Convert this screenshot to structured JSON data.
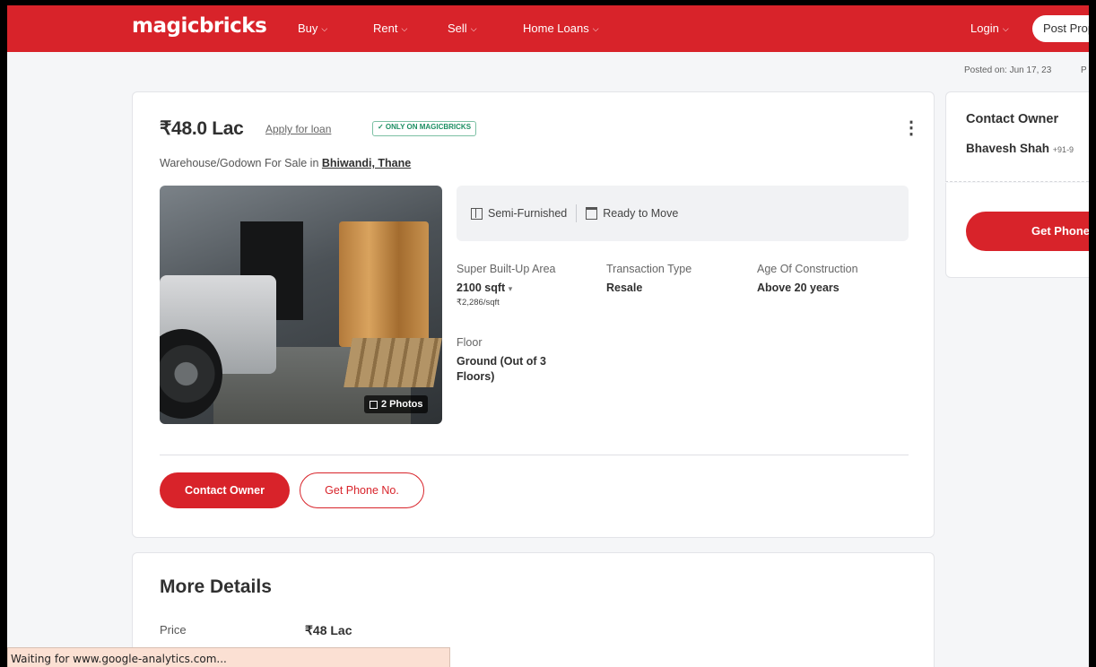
{
  "header": {
    "logo": "magicbricks",
    "nav": [
      {
        "label": "Buy"
      },
      {
        "label": "Rent"
      },
      {
        "label": "Sell"
      },
      {
        "label": "Home Loans"
      }
    ],
    "login_label": "Login",
    "post_property_label": "Post Prop",
    "brand_color": "#d8232a"
  },
  "posted_on": "Posted on: Jun 17, 23",
  "posted_on_trailing": "P",
  "listing": {
    "price": "₹48.0 Lac",
    "apply_loan": "Apply for loan",
    "badge": "✓ ONLY ON MAGICBRICKS",
    "more_icon": "⋮",
    "subtitle_prefix": "Warehouse/Godown For Sale in",
    "location": "Bhiwandi, Thane",
    "photos_badge": "2 Photos",
    "furnishing": "Semi-Furnished",
    "possession": "Ready to Move",
    "attributes": {
      "area_label": "Super Built-Up Area",
      "area_value": "2100 sqft",
      "area_rate": "₹2,286/sqft",
      "transaction_label": "Transaction Type",
      "transaction_value": "Resale",
      "age_label": "Age Of Construction",
      "age_value": "Above 20 years",
      "floor_label": "Floor",
      "floor_value": "Ground (Out of 3 Floors)"
    },
    "contact_button": "Contact Owner",
    "phone_button": "Get Phone No."
  },
  "more_details": {
    "title": "More Details",
    "price_label": "Price",
    "price_value": "₹48 Lac"
  },
  "sidebar": {
    "title": "Contact Owner",
    "owner_name": "Bhavesh Shah",
    "owner_phone": "+91-9",
    "get_phone_button": "Get Phone"
  },
  "statusbar": "Waiting for www.google-analytics.com..."
}
